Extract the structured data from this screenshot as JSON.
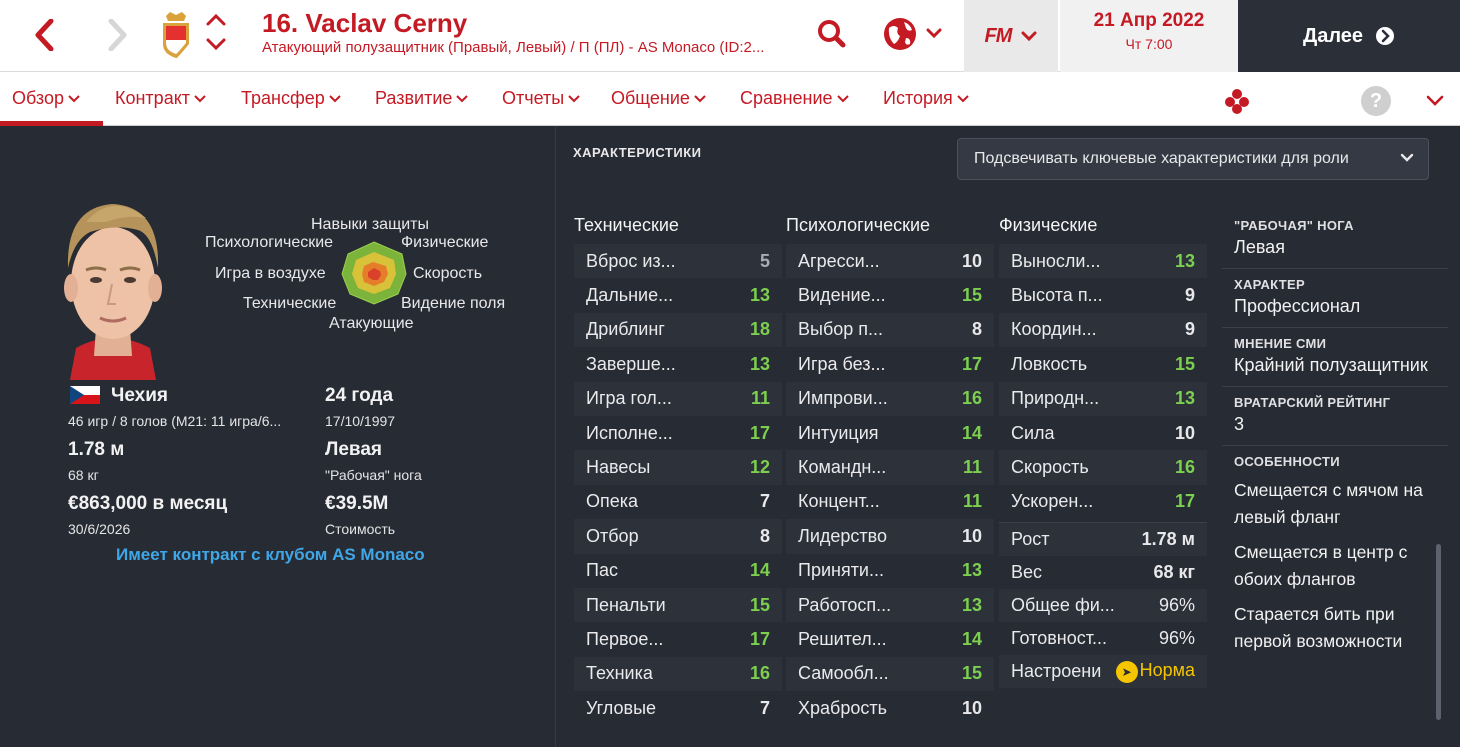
{
  "header": {
    "title": "16. Vaclav Cerny",
    "subtitle": "Атакующий полузащитник (Правый, Левый) / П (ПЛ) - AS Monaco (ID:2...",
    "fm_logo": "FM",
    "date": "21 Апр 2022",
    "day_time": "Чт 7:00",
    "continue_label": "Далее"
  },
  "menu": [
    {
      "label": "Обзор"
    },
    {
      "label": "Контракт"
    },
    {
      "label": "Трансфер"
    },
    {
      "label": "Развитие"
    },
    {
      "label": "Отчеты"
    },
    {
      "label": "Общение"
    },
    {
      "label": "Сравнение"
    },
    {
      "label": "История"
    }
  ],
  "help_label": "?",
  "radar": {
    "labels": [
      "Навыки защиты",
      "Психологические",
      "Физические",
      "Игра в воздухе",
      "Скорость",
      "Технические",
      "Видение поля",
      "Атакующие"
    ]
  },
  "profile": {
    "nationality": "Чехия",
    "caps": "46 игр / 8 голов (M21: 11 игра/6...",
    "age": "24 года",
    "dob": "17/10/1997",
    "height": "1.78 м",
    "weight": "68 кг",
    "foot": "Левая",
    "foot_label": "\"Рабочая\" нога",
    "wage": "€863,000 в месяц",
    "contract_end": "30/6/2026",
    "value": "€39.5M",
    "value_label": "Стоимость",
    "contract_link": "Имеет контракт с клубом AS Monaco"
  },
  "attributes": {
    "header": "ХАРАКТЕРИСТИКИ",
    "highlight_select": "Подсвечивать ключевые характеристики для роли",
    "technical": {
      "title": "Технические",
      "rows": [
        {
          "name": "Вброс из...",
          "value": "5"
        },
        {
          "name": "Дальние...",
          "value": "13"
        },
        {
          "name": "Дриблинг",
          "value": "18"
        },
        {
          "name": "Заверше...",
          "value": "13"
        },
        {
          "name": "Игра гол...",
          "value": "11"
        },
        {
          "name": "Исполне...",
          "value": "17"
        },
        {
          "name": "Навесы",
          "value": "12"
        },
        {
          "name": "Опека",
          "value": "7"
        },
        {
          "name": "Отбор",
          "value": "8"
        },
        {
          "name": "Пас",
          "value": "14"
        },
        {
          "name": "Пенальти",
          "value": "15"
        },
        {
          "name": "Первое...",
          "value": "17"
        },
        {
          "name": "Техника",
          "value": "16"
        },
        {
          "name": "Угловые",
          "value": "7"
        }
      ]
    },
    "mental": {
      "title": "Психологические",
      "rows": [
        {
          "name": "Агресси...",
          "value": "10"
        },
        {
          "name": "Видение...",
          "value": "15"
        },
        {
          "name": "Выбор п...",
          "value": "8"
        },
        {
          "name": "Игра без...",
          "value": "17"
        },
        {
          "name": "Импрови...",
          "value": "16"
        },
        {
          "name": "Интуиция",
          "value": "14"
        },
        {
          "name": "Командн...",
          "value": "11"
        },
        {
          "name": "Концент...",
          "value": "11"
        },
        {
          "name": "Лидерство",
          "value": "10"
        },
        {
          "name": "Приняти...",
          "value": "13"
        },
        {
          "name": "Работосп...",
          "value": "13"
        },
        {
          "name": "Решител...",
          "value": "14"
        },
        {
          "name": "Самообл...",
          "value": "15"
        },
        {
          "name": "Храбрость",
          "value": "10"
        }
      ]
    },
    "physical": {
      "title": "Физические",
      "rows": [
        {
          "name": "Выносли...",
          "value": "13"
        },
        {
          "name": "Высота п...",
          "value": "9"
        },
        {
          "name": "Координ...",
          "value": "9"
        },
        {
          "name": "Ловкость",
          "value": "15"
        },
        {
          "name": "Природн...",
          "value": "13"
        },
        {
          "name": "Сила",
          "value": "10"
        },
        {
          "name": "Скорость",
          "value": "16"
        },
        {
          "name": "Ускорен...",
          "value": "17"
        }
      ],
      "extra": [
        {
          "name": "Рост",
          "value": "1.78 м"
        },
        {
          "name": "Вес",
          "value": "68 кг"
        },
        {
          "name": "Общее фи...",
          "value": "96%"
        },
        {
          "name": "Готовност...",
          "value": "96%"
        }
      ],
      "morale_label": "Настроени",
      "morale_value": "Норма"
    }
  },
  "side_info": {
    "foot_label": "\"РАБОЧАЯ\" НОГА",
    "foot_value": "Левая",
    "personality_label": "ХАРАКТЕР",
    "personality_value": "Профессионал",
    "media_label": "МНЕНИЕ СМИ",
    "media_value": "Крайний полузащитник",
    "gk_label": "ВРАТАРСКИЙ РЕЙТИНГ",
    "gk_value": "3",
    "traits_label": "ОСОБЕННОСТИ",
    "traits": [
      "Смещается с мячом на левый фланг",
      "Смещается в центр с обоих флангов",
      "Старается бить при первой возможности"
    ]
  },
  "colors": {
    "accent": "#c41a24",
    "background": "#272b33",
    "high_attr": "#7ccf4f",
    "link": "#3fa7e8",
    "morale": "#f5c500"
  }
}
